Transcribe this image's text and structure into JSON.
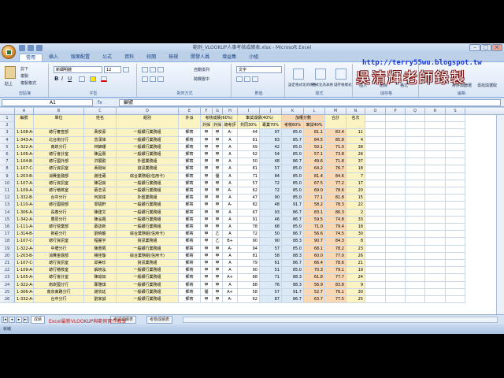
{
  "window": {
    "title": "範例_VLOOKUP人事考核成績表.xlsx - Microsoft Excel"
  },
  "ribbon_tabs": [
    "常用",
    "插入",
    "版面配置",
    "公式",
    "資料",
    "校閱",
    "檢視",
    "開發人員",
    "增益集",
    "小組"
  ],
  "clipboard": {
    "paste": "貼上",
    "cut": "剪下",
    "copy": "複製",
    "format_painter": "複製格式",
    "label": "剪貼簿"
  },
  "font": {
    "name": "新細明體",
    "size": "12",
    "label": "字型"
  },
  "alignment": {
    "wrap": "自動換列",
    "merge": "跨欄置中",
    "label": "對齊方式"
  },
  "number": {
    "format": "文字",
    "label": "數值"
  },
  "styles": {
    "cond": "設定格式化的條件",
    "table": "格式化為表格",
    "cell": "儲存格樣式",
    "label": "樣式"
  },
  "cells": {
    "insert": "插入",
    "delete": "刪除",
    "format": "格式",
    "label": "儲存格"
  },
  "editing": {
    "sort": "排序與篩選",
    "find": "尋找與選取",
    "label": "編輯"
  },
  "formula_bar": {
    "name_box": "A1",
    "fx": "fx",
    "content": "編號"
  },
  "columns": [
    "A",
    "B",
    "C",
    "D",
    "E",
    "F",
    "G",
    "H",
    "I",
    "J",
    "K",
    "L",
    "M",
    "N",
    "O",
    "P",
    "Q",
    "R",
    "S"
  ],
  "header1": {
    "no": "編號",
    "unit": "單位",
    "name": "姓名",
    "group": "組別",
    "post": "外派",
    "appraisal": "考核成績(60%)",
    "written": "筆試成績(40%)",
    "bonus": "加權分數",
    "total": "合計",
    "rank": "名次"
  },
  "header2": {
    "f": "外採",
    "g": "外採",
    "h": "總考評",
    "i": "共同30%",
    "j": "專業70%",
    "k": "考核60%",
    "l": "筆試40%"
  },
  "rows": [
    [
      "1-108-A-01",
      "總行審查部",
      "黃俊豪",
      "一般銀行業務組",
      "郵寄",
      "甲",
      "甲",
      "A-",
      "44",
      "97",
      "85.0",
      "81.1",
      "83.4",
      "11"
    ],
    [
      "1-343-A-02",
      "北台南分行",
      "曾漢偉",
      "一般銀行業務組",
      "郵寄",
      "甲",
      "甲",
      "A",
      "81",
      "83",
      "85.7",
      "84.5",
      "85.8",
      "4"
    ],
    [
      "1-322-A-03",
      "南崁分行",
      "林錦珊",
      "一般銀行業務組",
      "郵寄",
      "甲",
      "甲",
      "A",
      "69",
      "42",
      "85.0",
      "50.1",
      "71.0",
      "38"
    ],
    [
      "1-106-A-04",
      "總行會計室",
      "陳品惠",
      "一般銀行業務組",
      "郵寄",
      "甲",
      "甲",
      "A",
      "62",
      "54",
      "85.0",
      "57.1",
      "73.8",
      "26"
    ],
    [
      "1-104-B-05",
      "總行國外部",
      "洪展勤",
      "外匯業務組",
      "郵寄",
      "甲",
      "甲",
      "A",
      "50",
      "48",
      "86.7",
      "49.6",
      "71.8",
      "37"
    ],
    [
      "1-107-C-06",
      "總行資訊室",
      "黃剛尚",
      "資訊業務組",
      "郵寄",
      "甲",
      "甲",
      "A",
      "81",
      "57",
      "85.0",
      "64.2",
      "76.7",
      "18"
    ],
    [
      "1-203-B-07",
      "消費金融部",
      "謝佳葳",
      "綜合業務組(信用卡)",
      "郵寄",
      "甲",
      "優",
      "A",
      "71",
      "84",
      "85.0",
      "81.4",
      "84.6",
      "7"
    ],
    [
      "1-107-A-08",
      "總行資訊室",
      "陳冠良",
      "一般銀行業務組",
      "郵寄",
      "甲",
      "甲",
      "A",
      "57",
      "72",
      "85.0",
      "67.5",
      "77.2",
      "17"
    ],
    [
      "1-109-A-09",
      "總行稽核室",
      "蔡志清",
      "一般銀行業務組",
      "郵寄",
      "甲",
      "甲",
      "A-",
      "62",
      "72",
      "85.0",
      "69.0",
      "78.6",
      "20"
    ],
    [
      "1-332-B-10",
      "台中分行",
      "何其偉",
      "外匯業務組",
      "郵寄",
      "甲",
      "甲",
      "A",
      "47",
      "90",
      "85.0",
      "77.1",
      "81.8",
      "15"
    ],
    [
      "1-110-A-11",
      "總行國營部",
      "郭駿軒",
      "一般銀行業務組",
      "郵寄",
      "甲",
      "甲",
      "A-",
      "82",
      "48",
      "91.7",
      "58.2",
      "78.3",
      "22"
    ],
    [
      "1-306-A-12",
      "長春分行",
      "陳建文",
      "一般銀行業務組",
      "郵寄",
      "甲",
      "甲",
      "A",
      "67",
      "93",
      "86.7",
      "83.1",
      "86.3",
      "2"
    ],
    [
      "1-342-A-13",
      "豐原分行",
      "陳泓楓",
      "一般銀行業務組",
      "郵寄",
      "甲",
      "甲",
      "A",
      "91",
      "46",
      "86.7",
      "59.5",
      "74.8",
      "33"
    ],
    [
      "1-111-A-14",
      "總行營業部",
      "蔡誌新",
      "一般銀行業務組",
      "郵寄",
      "甲",
      "甲",
      "A",
      "78",
      "68",
      "85.0",
      "71.0",
      "79.4",
      "18"
    ],
    [
      "1-314-B-15",
      "新莊分行",
      "劉曉龍",
      "綜合業務組(信用卡)",
      "郵寄",
      "甲",
      "乙",
      "A",
      "72",
      "50",
      "86.7",
      "56.6",
      "74.5",
      "30"
    ],
    [
      "1-107-C-16",
      "總行資訊室",
      "程麗宇",
      "資訊業務組",
      "郵寄",
      "甲",
      "乙",
      "B+",
      "90",
      "90",
      "88.3",
      "90.7",
      "84.3",
      "8"
    ],
    [
      "1-322-A-17",
      "中壢分行",
      "陳惠珮",
      "一般銀行業務組",
      "郵寄",
      "甲",
      "甲",
      "A-",
      "94",
      "57",
      "85.0",
      "68.1",
      "78.2",
      "23"
    ],
    [
      "1-203-B-18",
      "消費金融部",
      "楊佳璇",
      "綜合業務組(信用卡)",
      "郵寄",
      "甲",
      "甲",
      "A",
      "81",
      "58",
      "88.3",
      "60.0",
      "77.0",
      "26"
    ],
    [
      "1-107-C-19",
      "總行資訊室",
      "邱美珍",
      "資訊業務組",
      "郵寄",
      "甲",
      "甲",
      "A",
      "79",
      "61",
      "86.7",
      "66.4",
      "78.6",
      "21"
    ],
    [
      "1-109-A-20",
      "總行稽核室",
      "解晓泓",
      "一般銀行業務組",
      "郵寄",
      "甲",
      "甲",
      "A",
      "90",
      "51",
      "85.0",
      "70.3",
      "79.1",
      "19"
    ],
    [
      "1-105-A-21",
      "總行會計室",
      "陳瑜如",
      "一般銀行業務組",
      "郵寄",
      "甲",
      "甲",
      "A+",
      "88",
      "71",
      "88.3",
      "61.8",
      "77.7",
      "24"
    ],
    [
      "1-322-A-22",
      "南崁國分行",
      "鄭雅琪",
      "一般銀行業務組",
      "郵寄",
      "甲",
      "甲",
      "A",
      "88",
      "76",
      "88.3",
      "56.9",
      "83.8",
      "9"
    ],
    [
      "1-306-A-23",
      "南京東路分行",
      "謝欣廷",
      "一般銀行業務組",
      "郵寄",
      "優",
      "甲",
      "A+",
      "58",
      "57",
      "91.7",
      "52.7",
      "76.1",
      "30"
    ],
    [
      "1-332-A-24",
      "台中分行",
      "劉家誠",
      "一般銀行業務組",
      "郵寄",
      "甲",
      "甲",
      "A-",
      "62",
      "87",
      "86.7",
      "63.7",
      "77.5",
      "25"
    ]
  ],
  "sheet_tabs": [
    "成績",
    "考試成績表",
    "考核成績表"
  ],
  "marquee": "Excel最新VLOOKUP與範例實作教學",
  "status": "就緒",
  "watermark": {
    "url": "http://terry55wu.blogspot.tw",
    "brand": "吳清輝老師錄製"
  }
}
